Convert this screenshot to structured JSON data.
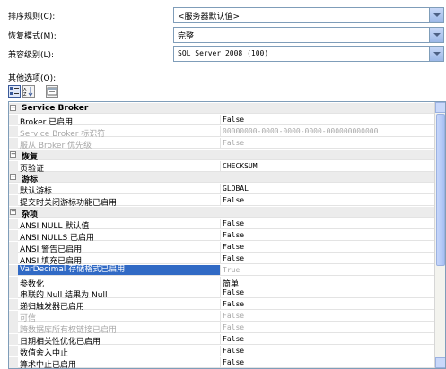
{
  "form": {
    "collation": {
      "label": "排序规则(C):",
      "value": "<服务器默认值>"
    },
    "recovery": {
      "label": "恢复模式(M):",
      "value": "完整"
    },
    "compat": {
      "label": "兼容级别(L):",
      "value": "SQL Server 2008 (100)"
    }
  },
  "other_options_label": "其他选项(O):",
  "toolbar": {
    "categorized_icon": "categorized-icon",
    "alphabetical_icon": "sort-az-icon",
    "property_pages_icon": "property-pages-icon"
  },
  "grid": {
    "rows": [
      {
        "type": "category",
        "name": "Service Broker"
      },
      {
        "type": "prop",
        "name": "Broker 已启用",
        "value": "False"
      },
      {
        "type": "prop",
        "name": "Service Broker 标识符",
        "value": "00000000-0000-0000-0000-000000000000",
        "disabled": true
      },
      {
        "type": "prop",
        "name": "服从 Broker 优先级",
        "value": "False",
        "disabled": true
      },
      {
        "type": "category",
        "name": "恢复"
      },
      {
        "type": "prop",
        "name": "页验证",
        "value": "CHECKSUM"
      },
      {
        "type": "category",
        "name": "游标"
      },
      {
        "type": "prop",
        "name": "默认游标",
        "value": "GLOBAL"
      },
      {
        "type": "prop",
        "name": "提交时关闭游标功能已启用",
        "value": "False"
      },
      {
        "type": "category",
        "name": "杂项"
      },
      {
        "type": "prop",
        "name": "ANSI NULL 默认值",
        "value": "False"
      },
      {
        "type": "prop",
        "name": "ANSI NULLS 已启用",
        "value": "False"
      },
      {
        "type": "prop",
        "name": "ANSI 警告已启用",
        "value": "False"
      },
      {
        "type": "prop",
        "name": "ANSI 填充已启用",
        "value": "False"
      },
      {
        "type": "prop",
        "name": "VarDecimal 存储格式已启用",
        "value": "True",
        "selected": true
      },
      {
        "type": "prop",
        "name": "参数化",
        "value": "简单",
        "cjk": true
      },
      {
        "type": "prop",
        "name": "串联的 Null 结果为 Null",
        "value": "False"
      },
      {
        "type": "prop",
        "name": "递归触发器已启用",
        "value": "False"
      },
      {
        "type": "prop",
        "name": "可信",
        "value": "False",
        "disabled": true
      },
      {
        "type": "prop",
        "name": "跨数据库所有权链接已启用",
        "value": "False",
        "disabled": true
      },
      {
        "type": "prop",
        "name": "日期相关性优化已启用",
        "value": "False"
      },
      {
        "type": "prop",
        "name": "数值舍入中止",
        "value": "False"
      },
      {
        "type": "prop",
        "name": "算术中止已启用",
        "value": "False"
      }
    ]
  }
}
